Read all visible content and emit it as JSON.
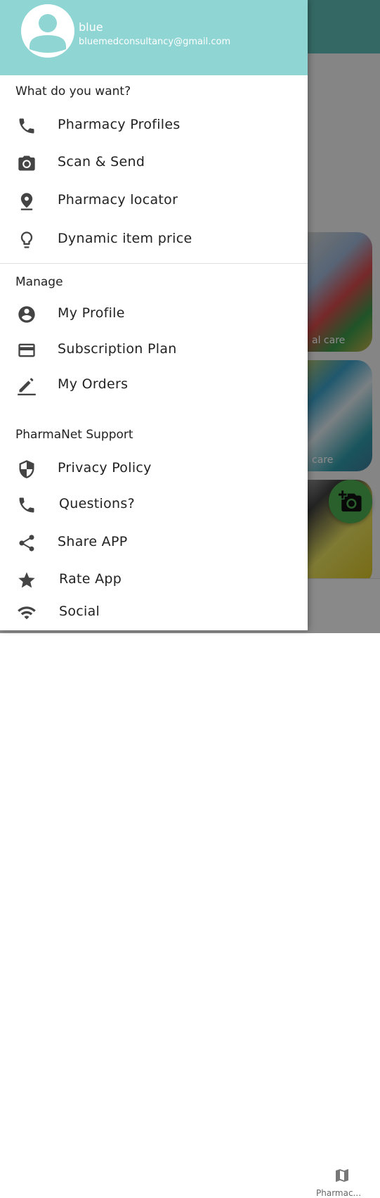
{
  "user": {
    "name": "blue",
    "email": "bluemedconsultancy@gmail.com"
  },
  "sections": {
    "want": "What do you want?",
    "manage": "Manage",
    "support": "PharmaNet Support"
  },
  "menu": {
    "pharmacy_profiles": "Pharmacy Profiles",
    "scan_send": "Scan & Send",
    "pharmacy_locator": "Pharmacy locator",
    "dynamic_price": "Dynamic item price",
    "my_profile": "My Profile",
    "subscription_plan": "Subscription Plan",
    "my_orders": "My Orders",
    "privacy_policy": "Privacy Policy",
    "questions": "Questions?",
    "share_app": "Share APP",
    "rate_app": "Rate App",
    "social": "Social"
  },
  "background": {
    "card1_label": "al care",
    "card2_label": "care",
    "bottom_nav_label": "Pharmac..."
  },
  "colors": {
    "drawer_header": "#8fd5d3",
    "app_header": "#5fbdb7",
    "fab": "#4caf50"
  }
}
